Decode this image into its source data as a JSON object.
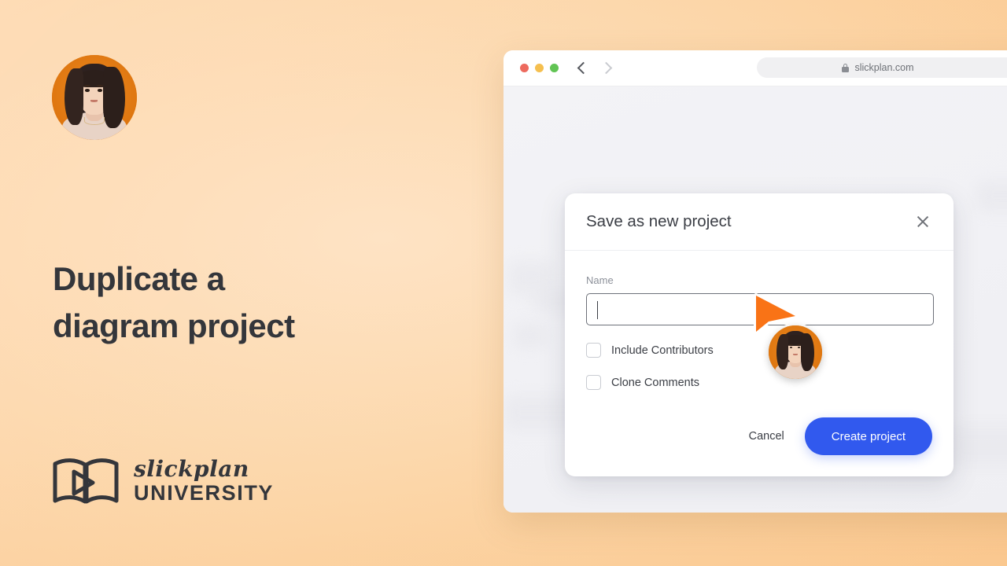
{
  "slide": {
    "headline_line1": "Duplicate a",
    "headline_line2": "diagram project",
    "background_color": "#FBCF9C",
    "text_color": "#34363B"
  },
  "logo": {
    "script_text": "slickplan",
    "word_text": "UNIVERSITY",
    "mark": "open-book-with-play-icon"
  },
  "avatar": {
    "name": "presenter-avatar",
    "ring_color": "#E07B18"
  },
  "browser": {
    "traffic_lights": [
      {
        "name": "close",
        "color": "#ED6A5E"
      },
      {
        "name": "minimize",
        "color": "#F5BF4F"
      },
      {
        "name": "zoom",
        "color": "#61C454"
      }
    ],
    "back_icon": "chevron-left-icon",
    "forward_icon": "chevron-right-icon",
    "lock_icon": "lock-icon",
    "url": "slickplan.com"
  },
  "modal": {
    "title": "Save as new project",
    "close_icon": "close-icon",
    "name_label": "Name",
    "name_value": "",
    "name_placeholder": "",
    "checkboxes": [
      {
        "label": "Include Contributors",
        "checked": false
      },
      {
        "label": "Clone Comments",
        "checked": false
      }
    ],
    "cancel_label": "Cancel",
    "create_label": "Create project",
    "primary_color": "#3159EE"
  },
  "cursor": {
    "name": "collaborator-cursor",
    "color": "#F97316"
  }
}
